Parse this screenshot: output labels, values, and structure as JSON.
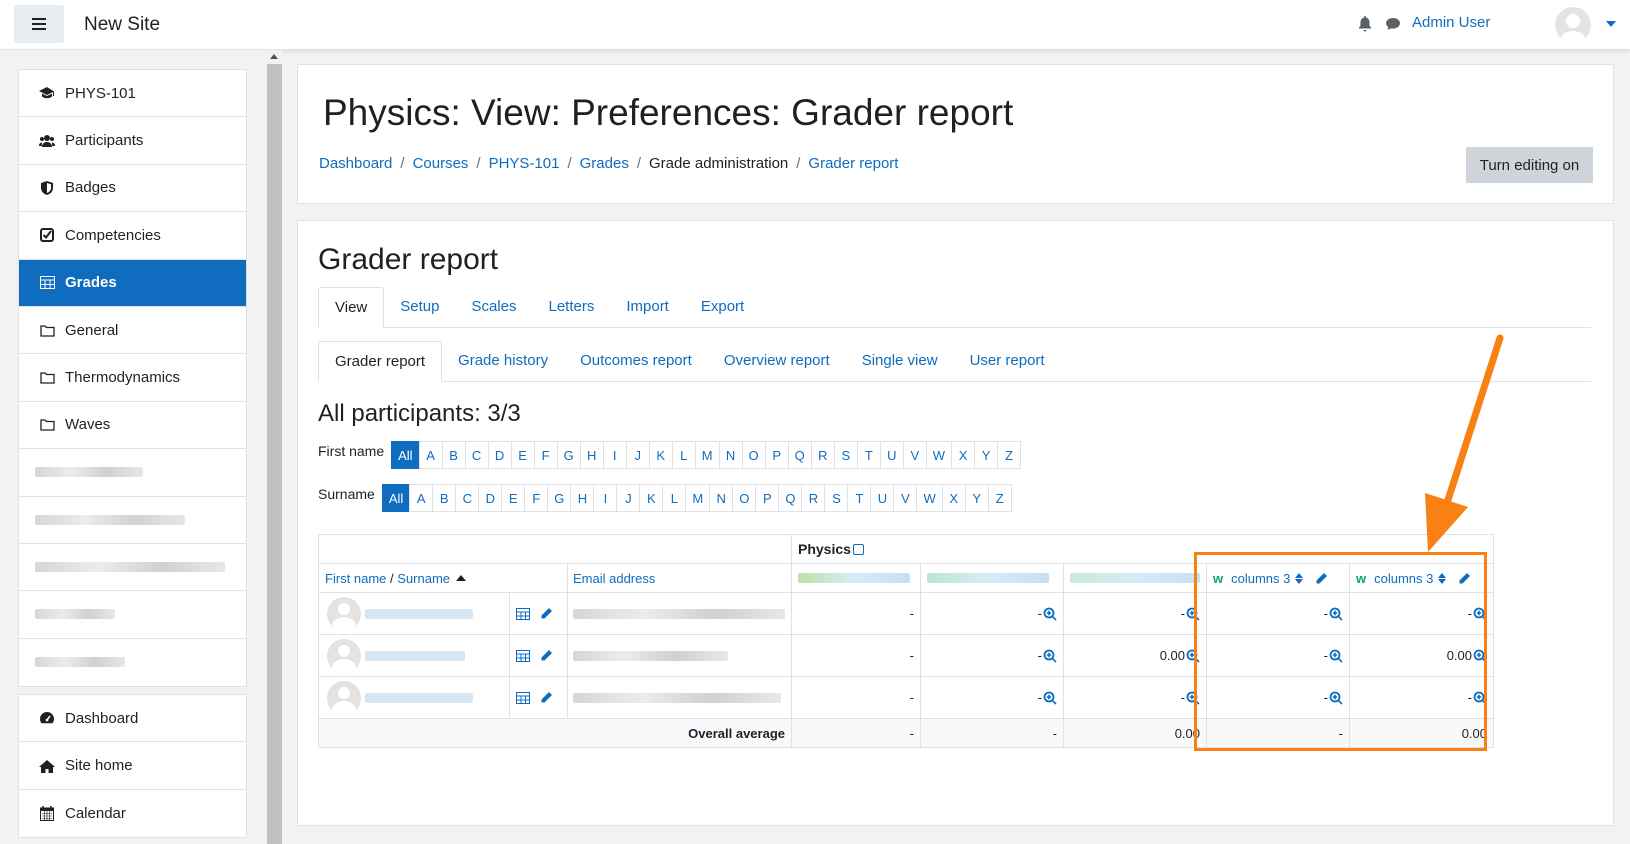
{
  "navbar": {
    "site_name": "New Site",
    "user_name": "Admin User",
    "icons": [
      "menu-icon",
      "bell-icon",
      "chat-icon",
      "avatar",
      "caret-down-icon"
    ]
  },
  "drawer": {
    "items": [
      {
        "label": "PHYS-101",
        "icon": "graduation-cap-icon"
      },
      {
        "label": "Participants",
        "icon": "users-icon"
      },
      {
        "label": "Badges",
        "icon": "shield-icon"
      },
      {
        "label": "Competencies",
        "icon": "check-square-icon"
      },
      {
        "label": "Grades",
        "icon": "table-icon",
        "active": true
      },
      {
        "label": "General",
        "icon": "folder-icon"
      },
      {
        "label": "Thermodynamics",
        "icon": "folder-icon"
      },
      {
        "label": "Waves",
        "icon": "folder-icon"
      }
    ],
    "bottom_items": [
      {
        "label": "Dashboard",
        "icon": "tachometer-icon"
      },
      {
        "label": "Site home",
        "icon": "home-icon"
      },
      {
        "label": "Calendar",
        "icon": "calendar-icon"
      }
    ]
  },
  "header": {
    "title": "Physics: View: Preferences: Grader report",
    "breadcrumb": [
      "Dashboard",
      "Courses",
      "PHYS-101",
      "Grades",
      "Grade administration",
      "Grader report"
    ],
    "edit_button": "Turn editing on"
  },
  "main": {
    "heading": "Grader report",
    "tabs": [
      "View",
      "Setup",
      "Scales",
      "Letters",
      "Import",
      "Export"
    ],
    "subtabs": [
      "Grader report",
      "Grade history",
      "Outcomes report",
      "Overview report",
      "Single view",
      "User report"
    ],
    "participants_title": "All participants: 3/3",
    "first_name_label": "First name",
    "surname_label": "Surname",
    "letters": [
      "All",
      "A",
      "B",
      "C",
      "D",
      "E",
      "F",
      "G",
      "H",
      "I",
      "J",
      "K",
      "L",
      "M",
      "N",
      "O",
      "P",
      "Q",
      "R",
      "S",
      "T",
      "U",
      "V",
      "W",
      "X",
      "Y",
      "Z"
    ]
  },
  "grader": {
    "category": "Physics",
    "col_firstname": "First name",
    "col_slash": " / ",
    "col_surname": "Surname",
    "col_email": "Email address",
    "columns": [
      {
        "label": "columns 3",
        "icon": "w-icon"
      },
      {
        "label": "columns 3",
        "icon": "w-icon"
      }
    ],
    "rows": [
      [
        "-",
        "-",
        "-",
        "-",
        "-"
      ],
      [
        "-",
        "-",
        "0.00",
        "-",
        "0.00"
      ],
      [
        "-",
        "-",
        "-",
        "-",
        "-"
      ]
    ],
    "overall_label": "Overall average",
    "overall": [
      "-",
      "-",
      "0.00",
      "-",
      "0.00"
    ]
  },
  "colors": {
    "link": "#0f6cbf",
    "active_tab": "#0f6cbf",
    "highlight": "#f98012",
    "button_bg": "#ced4da"
  }
}
